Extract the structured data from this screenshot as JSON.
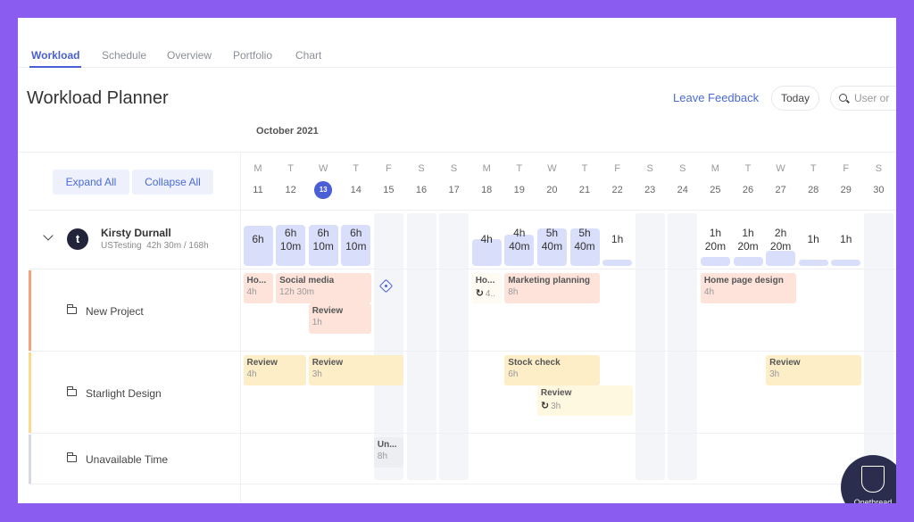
{
  "tabs": [
    {
      "label": "Workload",
      "active": true
    },
    {
      "label": "Schedule",
      "active": false
    },
    {
      "label": "Overview",
      "active": false
    },
    {
      "label": "Portfolio",
      "active": false
    },
    {
      "label": "Chart",
      "active": false
    }
  ],
  "page_title": "Workload Planner",
  "header": {
    "feedback_label": "Leave Feedback",
    "today_label": "Today",
    "search_placeholder": "User or"
  },
  "month_label": "October 2021",
  "controls": {
    "expand_all": "Expand All",
    "collapse_all": "Collapse All"
  },
  "days": [
    {
      "dow": "M",
      "num": "11"
    },
    {
      "dow": "T",
      "num": "12"
    },
    {
      "dow": "W",
      "num": "13",
      "today": true
    },
    {
      "dow": "T",
      "num": "14"
    },
    {
      "dow": "F",
      "num": "15"
    },
    {
      "dow": "S",
      "num": "16",
      "weekend": true
    },
    {
      "dow": "S",
      "num": "17",
      "weekend": true
    },
    {
      "dow": "M",
      "num": "18"
    },
    {
      "dow": "T",
      "num": "19"
    },
    {
      "dow": "W",
      "num": "20"
    },
    {
      "dow": "T",
      "num": "21"
    },
    {
      "dow": "F",
      "num": "22"
    },
    {
      "dow": "S",
      "num": "23",
      "weekend": true
    },
    {
      "dow": "S",
      "num": "24",
      "weekend": true
    },
    {
      "dow": "M",
      "num": "25"
    },
    {
      "dow": "T",
      "num": "26"
    },
    {
      "dow": "W",
      "num": "27"
    },
    {
      "dow": "T",
      "num": "28"
    },
    {
      "dow": "F",
      "num": "29"
    },
    {
      "dow": "S",
      "num": "30",
      "weekend": true
    }
  ],
  "person": {
    "name": "Kirsty Durnall",
    "avatar_letter": "t",
    "team": "USTesting",
    "hours": "42h 30m / 168h",
    "daily_load": [
      {
        "day": "11",
        "label": "6h",
        "hours": 6
      },
      {
        "day": "12",
        "label": "6h 10m",
        "hours": 6.17
      },
      {
        "day": "13",
        "label": "6h 10m",
        "hours": 6.17
      },
      {
        "day": "14",
        "label": "6h 10m",
        "hours": 6.17
      },
      {
        "day": "15",
        "label": "",
        "hours": 0
      },
      {
        "day": "16",
        "label": "",
        "hours": 0
      },
      {
        "day": "17",
        "label": "",
        "hours": 0
      },
      {
        "day": "18",
        "label": "4h",
        "hours": 4
      },
      {
        "day": "19",
        "label": "4h 40m",
        "hours": 4.67
      },
      {
        "day": "20",
        "label": "5h 40m",
        "hours": 5.67
      },
      {
        "day": "21",
        "label": "5h 40m",
        "hours": 5.67
      },
      {
        "day": "22",
        "label": "1h",
        "hours": 1
      },
      {
        "day": "23",
        "label": "",
        "hours": 0
      },
      {
        "day": "24",
        "label": "",
        "hours": 0
      },
      {
        "day": "25",
        "label": "1h 20m",
        "hours": 1.33
      },
      {
        "day": "26",
        "label": "1h 20m",
        "hours": 1.33
      },
      {
        "day": "27",
        "label": "2h 20m",
        "hours": 2.33
      },
      {
        "day": "28",
        "label": "1h",
        "hours": 1
      },
      {
        "day": "29",
        "label": "1h",
        "hours": 1
      },
      {
        "day": "30",
        "label": "",
        "hours": 0
      }
    ]
  },
  "projects": [
    {
      "name": "New Project",
      "color": "#f5a27a"
    },
    {
      "name": "Starlight Design",
      "color": "#fcd98c"
    },
    {
      "name": "Unavailable Time",
      "color": "#d6d9e2"
    }
  ],
  "tasks": [
    {
      "project": 0,
      "name": "Ho...",
      "hours": "4h",
      "start": 0,
      "span": 1,
      "lane": 0,
      "style": "pink"
    },
    {
      "project": 0,
      "name": "Social media",
      "hours": "12h 30m",
      "start": 1,
      "span": 3,
      "lane": 0,
      "style": "pink"
    },
    {
      "project": 0,
      "name": "Review",
      "hours": "1h",
      "start": 2,
      "span": 2,
      "lane": 1,
      "style": "pink"
    },
    {
      "project": 0,
      "name": "Ho...",
      "hours": "4..",
      "start": 7,
      "span": 1,
      "lane": 0,
      "style": "pale",
      "recurring": true
    },
    {
      "project": 0,
      "name": "Marketing planning",
      "hours": "8h",
      "start": 8,
      "span": 3,
      "lane": 0,
      "style": "pink"
    },
    {
      "project": 0,
      "name": "Home page design",
      "hours": "4h",
      "start": 14,
      "span": 3,
      "lane": 0,
      "style": "pink"
    },
    {
      "project": 1,
      "name": "Review",
      "hours": "4h",
      "start": 0,
      "span": 2,
      "lane": 0,
      "style": "yellow"
    },
    {
      "project": 1,
      "name": "Review",
      "hours": "3h",
      "start": 2,
      "span": 3,
      "lane": 0,
      "style": "yellow"
    },
    {
      "project": 1,
      "name": "Stock check",
      "hours": "6h",
      "start": 8,
      "span": 3,
      "lane": 0,
      "style": "yellow"
    },
    {
      "project": 1,
      "name": "Review",
      "hours": "3h",
      "start": 9,
      "span": 3,
      "lane": 1,
      "style": "lightyellow",
      "recurring": true
    },
    {
      "project": 1,
      "name": "Review",
      "hours": "3h",
      "start": 16,
      "span": 3,
      "lane": 0,
      "style": "yellow"
    },
    {
      "project": 2,
      "name": "Un...",
      "hours": "8h",
      "start": 4,
      "span": 1,
      "lane": 0,
      "style": "grey"
    }
  ],
  "logo_text": "Onethread"
}
